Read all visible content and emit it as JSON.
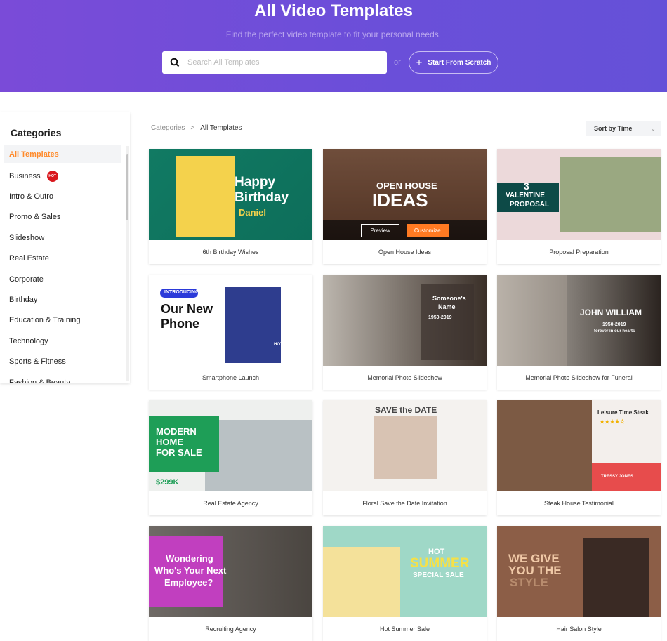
{
  "hero": {
    "title": "All Video Templates",
    "subtitle": "Find the perfect video template to fit your personal needs.",
    "search_placeholder": "Search All Templates",
    "search_value": "",
    "or": "or",
    "scratch_label": "Start From Scratch"
  },
  "sidebar": {
    "title": "Categories",
    "items": [
      {
        "label": "All Templates",
        "active": true
      },
      {
        "label": "Business",
        "badge": "HOT"
      },
      {
        "label": "Intro & Outro"
      },
      {
        "label": "Promo & Sales"
      },
      {
        "label": "Slideshow"
      },
      {
        "label": "Real Estate"
      },
      {
        "label": "Corporate"
      },
      {
        "label": "Birthday"
      },
      {
        "label": "Education & Training"
      },
      {
        "label": "Technology"
      },
      {
        "label": "Sports & Fitness"
      },
      {
        "label": "Fashion & Beauty"
      }
    ]
  },
  "breadcrumb": {
    "root": "Categories",
    "sep": ">",
    "current": "All Templates"
  },
  "sort": {
    "label": "Sort by Time"
  },
  "hover_buttons": {
    "preview": "Preview",
    "customize": "Customize"
  },
  "colors": {
    "accent": "#ff8a2a",
    "hero": "#6f4fd8",
    "hot": "#d9161c"
  },
  "templates": [
    {
      "title": "6th Birthday Wishes",
      "lines": [
        "Happy",
        "Birthday",
        "Daniel"
      ]
    },
    {
      "title": "Open House Ideas",
      "lines": [
        "OPEN HOUSE",
        "IDEAS"
      ]
    },
    {
      "title": "Proposal Preparation",
      "lines": [
        "3",
        "VALENTINE",
        "PROPOSAL"
      ]
    },
    {
      "title": "Smartphone Launch",
      "lines": [
        "INTRODUCING",
        "Our New",
        "Phone",
        "HOT"
      ]
    },
    {
      "title": "Memorial Photo Slideshow",
      "lines": [
        "Someone's",
        "Name",
        "1950-2019"
      ]
    },
    {
      "title": "Memorial Photo Slideshow for Funeral",
      "lines": [
        "JOHN WILLIAM",
        "1950-2019",
        "forever in our hearts"
      ]
    },
    {
      "title": "Real Estate Agency",
      "lines": [
        "MODERN",
        "HOME",
        "FOR SALE",
        "$299K"
      ]
    },
    {
      "title": "Floral Save the Date Invitation",
      "lines": [
        "SAVE the DATE"
      ]
    },
    {
      "title": "Steak House Testimonial",
      "lines": [
        "Leisure Time Steak",
        "★★★★☆",
        "TRESSY JONES"
      ]
    },
    {
      "title": "Recruiting Agency",
      "lines": [
        "Wondering",
        "Who's Your Next",
        "Employee?"
      ]
    },
    {
      "title": "Hot Summer Sale",
      "lines": [
        "HOT",
        "SUMMER",
        "SPECIAL SALE"
      ]
    },
    {
      "title": "Hair Salon Style",
      "lines": [
        "WE GIVE",
        "YOU THE",
        "STYLE"
      ]
    }
  ]
}
